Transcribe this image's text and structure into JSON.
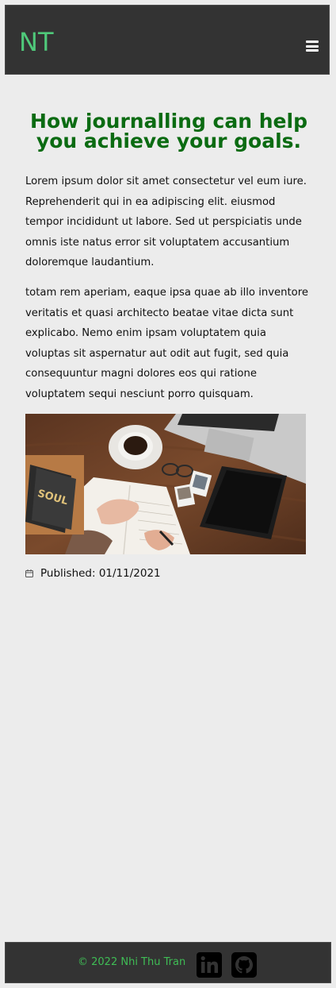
{
  "header": {
    "logo": "NT",
    "menu_icon": "hamburger-menu-icon"
  },
  "article": {
    "title": "How journalling can help you achieve your goals.",
    "paragraphs": [
      "Lorem ipsum dolor sit amet consectetur vel eum iure. Reprehenderit qui in ea adipiscing elit. eiusmod tempor incididunt ut labore. Sed ut perspiciatis unde omnis iste natus error sit voluptatem accusantium doloremque laudantium.",
      "totam rem aperiam, eaque ipsa quae ab illo inventore veritatis et quasi architecto beatae vitae dicta sunt explicabo. Nemo enim ipsam voluptatem quia voluptas sit aspernatur aut odit aut fugit, sed quia consequuntur magni dolores eos qui ratione voluptatem sequi nesciunt porro quisquam."
    ],
    "image_book_text": "SOUL",
    "published": "Published: 01/11/2021"
  },
  "footer": {
    "copyright": "© 2022 Nhi Thu Tran",
    "social": [
      "linkedin-icon",
      "github-icon"
    ]
  },
  "colors": {
    "bar_bg": "#333333",
    "page_bg": "#ececec",
    "title": "#0b6b12",
    "logo": "#4fc97a",
    "copyright": "#3fbd55"
  }
}
